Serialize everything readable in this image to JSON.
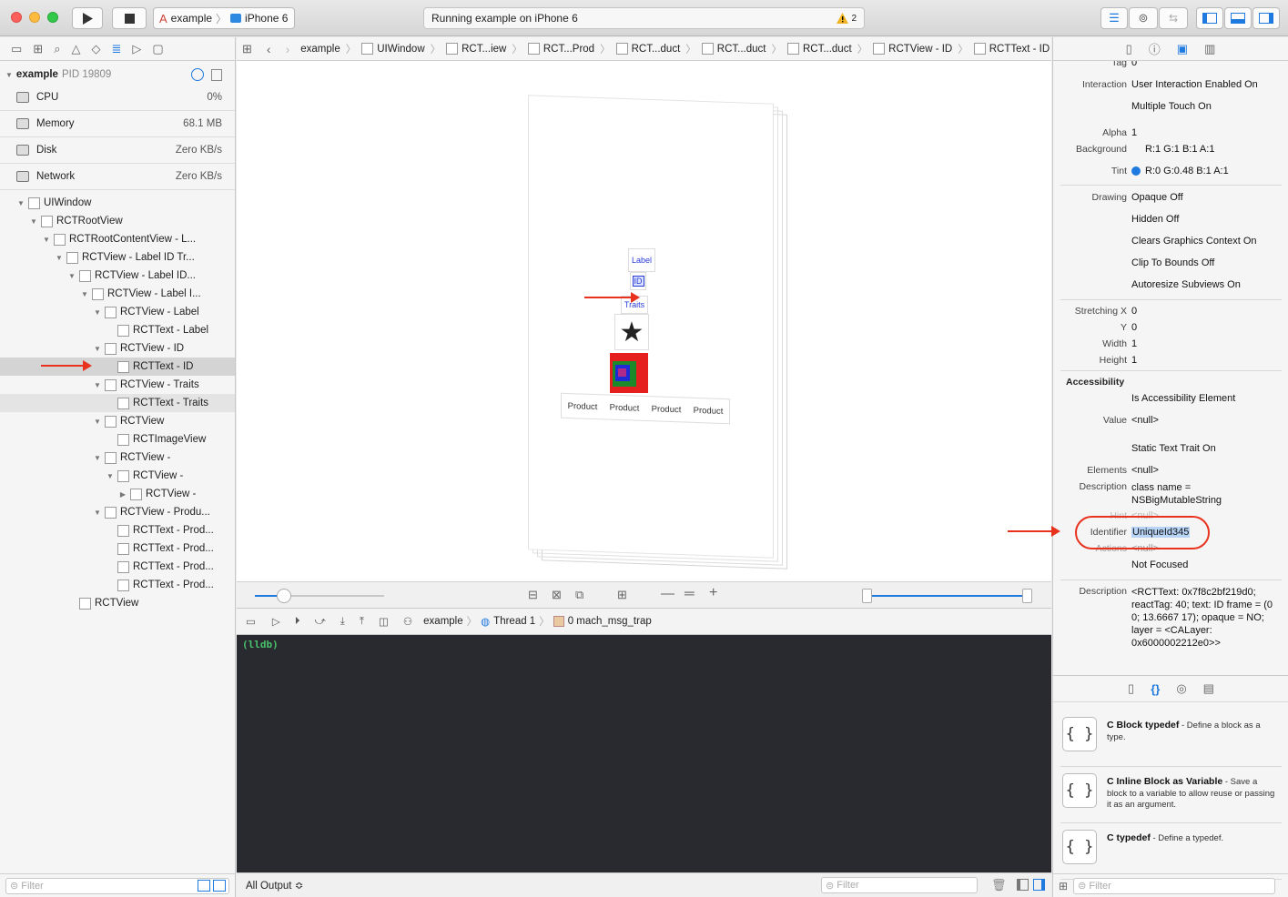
{
  "toolbar": {
    "scheme_target": "example",
    "scheme_device": "iPhone 6",
    "activity_text": "Running example on iPhone 6",
    "warning_count": "2"
  },
  "debug_nav": {
    "process_name": "example",
    "process_pid": "PID 19809",
    "gauges": [
      {
        "label": "CPU",
        "value": "0%"
      },
      {
        "label": "Memory",
        "value": "68.1 MB"
      },
      {
        "label": "Disk",
        "value": "Zero KB/s"
      },
      {
        "label": "Network",
        "value": "Zero KB/s"
      }
    ],
    "tree": [
      {
        "label": "UIWindow",
        "depth": 0,
        "tri": "▼"
      },
      {
        "label": "RCTRootView",
        "depth": 1,
        "tri": "▼"
      },
      {
        "label": "RCTRootContentView -      L...",
        "depth": 2,
        "tri": "▼"
      },
      {
        "label": "RCTView -      Label  ID  Tr...",
        "depth": 3,
        "tri": "▼"
      },
      {
        "label": "RCTView -      Label  ID...",
        "depth": 4,
        "tri": "▼"
      },
      {
        "label": "RCTView -   Label  I...",
        "depth": 5,
        "tri": "▼"
      },
      {
        "label": "RCTView -  Label",
        "depth": 6,
        "tri": "▼"
      },
      {
        "label": "RCTText - Label",
        "depth": 7,
        "tri": ""
      },
      {
        "label": "RCTView -  ID",
        "depth": 6,
        "tri": "▼"
      },
      {
        "label": "RCTText - ID",
        "depth": 7,
        "tri": "",
        "state": "sel"
      },
      {
        "label": "RCTView -  Traits",
        "depth": 6,
        "tri": "▼"
      },
      {
        "label": "RCTText - Traits",
        "depth": 7,
        "tri": "",
        "state": "hl"
      },
      {
        "label": "RCTView",
        "depth": 6,
        "tri": "▼"
      },
      {
        "label": "RCTImageView",
        "depth": 7,
        "tri": ""
      },
      {
        "label": "RCTView -",
        "depth": 6,
        "tri": "▼"
      },
      {
        "label": "RCTView -",
        "depth": 7,
        "tri": "▼"
      },
      {
        "label": "RCTView -",
        "depth": 8,
        "tri": "▶"
      },
      {
        "label": "RCTView -  Produ...",
        "depth": 6,
        "tri": "▼"
      },
      {
        "label": "RCTText - Prod...",
        "depth": 7,
        "tri": ""
      },
      {
        "label": "RCTText - Prod...",
        "depth": 7,
        "tri": ""
      },
      {
        "label": "RCTText - Prod...",
        "depth": 7,
        "tri": ""
      },
      {
        "label": "RCTText - Prod...",
        "depth": 7,
        "tri": ""
      },
      {
        "label": "RCTView",
        "depth": 4,
        "tri": ""
      }
    ],
    "filter_placeholder": "Filter"
  },
  "jumpbar": {
    "crumbs": [
      "example",
      "UIWindow",
      "RCT...iew",
      "RCT...Prod",
      "RCT...duct",
      "RCT...duct",
      "RCT...duct",
      "RCTView -  ID",
      "RCTText - ID"
    ]
  },
  "canvas": {
    "label_text": "Label",
    "id_text": "ID",
    "traits_text": "Traits",
    "star_glyph": "★",
    "products": [
      "Product",
      "Product",
      "Product",
      "Product"
    ]
  },
  "debugbar": {
    "process": "example",
    "thread": "Thread 1",
    "frame": "0 mach_msg_trap"
  },
  "console": {
    "prompt": "(lldb)",
    "output_selector": "All Output ≎",
    "filter_placeholder": "Filter"
  },
  "inspector": {
    "tag_label": "Tag",
    "tag_value": "0",
    "interaction_label": "Interaction",
    "interaction_1": "User Interaction Enabled On",
    "interaction_2": "Multiple Touch On",
    "alpha_label": "Alpha",
    "alpha_value": "1",
    "background_label": "Background",
    "background_value": "R:1 G:1 B:1 A:1",
    "tint_label": "Tint",
    "tint_value": "R:0 G:0.48 B:1 A:1",
    "drawing_label": "Drawing",
    "drawing_items": [
      "Opaque Off",
      "Hidden Off",
      "Clears Graphics Context On",
      "Clip To Bounds Off",
      "Autoresize Subviews On"
    ],
    "stretching_x_label": "Stretching X",
    "stretching_x": "0",
    "y_label": "Y",
    "y_value": "0",
    "width_label": "Width",
    "width_value": "1",
    "height_label": "Height",
    "height_value": "1",
    "accessibility_header": "Accessibility",
    "is_element": "Is Accessibility Element",
    "value_label": "Value",
    "value_value": "<null>",
    "static_text": "Static Text Trait On",
    "elements_label": "Elements",
    "elements_value": "<null>",
    "description_label": "Description",
    "description_value": "class name =\nNSBigMutableString",
    "hint_label": "Hint",
    "hint_value": "<null>",
    "identifier_label": "Identifier",
    "identifier_value": "UniqueId345",
    "actions_label": "Actions",
    "actions_value": "<null>",
    "focus_value": "Not Focused",
    "description2_label": "Description",
    "description2_value": "<RCTText: 0x7f8c2bf219d0; reactTag: 40; text: ID frame = (0 0; 13.6667 17); opaque = NO; layer = <CALayer: 0x6000002212e0>>"
  },
  "library": {
    "items": [
      {
        "title": "C Block typedef",
        "desc": " - Define a block as a type."
      },
      {
        "title": "C Inline Block as Variable",
        "desc": " - Save a block to a variable to allow reuse or passing it as an argument."
      },
      {
        "title": "C typedef",
        "desc": " - Define a typedef."
      }
    ],
    "filter_placeholder": "Filter"
  },
  "colors": {
    "accent": "#1f7ae0",
    "annotation_red": "#e8321e",
    "console_bg": "#292a30",
    "prompt_green": "#49c26c"
  }
}
